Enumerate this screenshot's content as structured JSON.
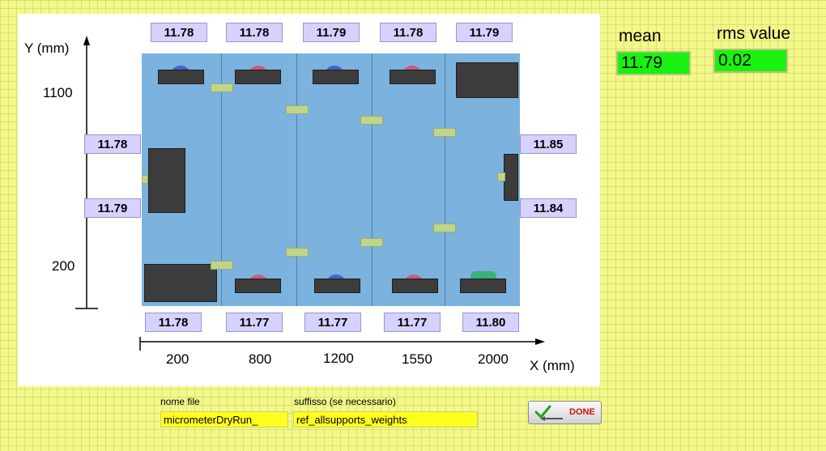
{
  "plot": {
    "y_axis_label": "Y (mm)",
    "x_axis_label": "X (mm)",
    "y_ticks": [
      "1100",
      "200"
    ],
    "x_ticks": [
      "200",
      "800",
      "1200",
      "1550",
      "2000"
    ],
    "top_values": [
      "11.78",
      "11.78",
      "11.79",
      "11.78",
      "11.79"
    ],
    "bottom_values": [
      "11.78",
      "11.77",
      "11.77",
      "11.77",
      "11.80"
    ],
    "left_values": [
      "11.78",
      "11.79"
    ],
    "right_values": [
      "11.85",
      "11.84"
    ],
    "colors": {
      "plate": "#7cb2de",
      "block": "#3c3c3c",
      "value_box": "#d6d2ff",
      "pad": "#bfd58b"
    }
  },
  "stats": {
    "mean_label": "mean",
    "mean_value": "11.79",
    "rms_label": "rms value",
    "rms_value": "0.02",
    "indicator_color": "#19f210"
  },
  "form": {
    "file_label": "nome file",
    "file_value": "micrometerDryRun_",
    "suffix_label": "suffisso (se necessario)",
    "suffix_value": "ref_allsupports_weights",
    "done_label": "DONE",
    "field_color": "#ffff20"
  },
  "icons": [
    "checkmark-pencil-icon"
  ]
}
